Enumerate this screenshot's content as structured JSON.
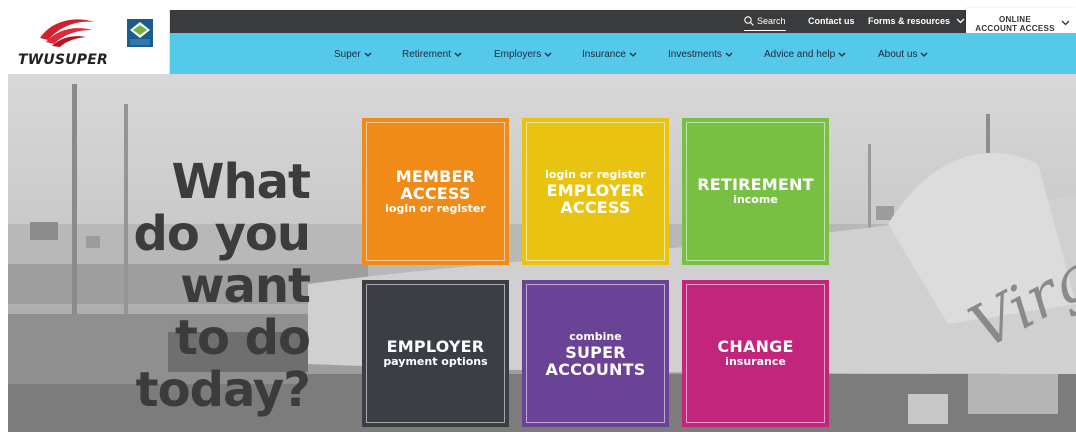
{
  "logo": {
    "text": "TWUSUPER"
  },
  "utility": {
    "search_label": "Search",
    "contact_label": "Contact us",
    "forms_label": "Forms & resources"
  },
  "online_access": {
    "line1": "ONLINE",
    "line2": "ACCOUNT ACCESS"
  },
  "nav": {
    "items": [
      {
        "label": "Super"
      },
      {
        "label": "Retirement"
      },
      {
        "label": "Employers"
      },
      {
        "label": "Insurance"
      },
      {
        "label": "Investments"
      },
      {
        "label": "Advice and help"
      },
      {
        "label": "About us"
      }
    ]
  },
  "hero": {
    "headline_lines": [
      "What",
      "do you",
      "want",
      "to do",
      "today?"
    ],
    "plane_text": "Virgin"
  },
  "tiles": {
    "member": {
      "big1": "MEMBER",
      "big2": "ACCESS",
      "small": "login or register"
    },
    "employer_access": {
      "small": "login or register",
      "big1": "EMPLOYER",
      "big2": "ACCESS"
    },
    "retirement": {
      "big": "RETIREMENT",
      "small": "income"
    },
    "employer_pay": {
      "big": "EMPLOYER",
      "small": "payment options"
    },
    "combine": {
      "small": "combine",
      "big1": "SUPER",
      "big2": "ACCOUNTS"
    },
    "change": {
      "big": "CHANGE",
      "small": "insurance"
    }
  },
  "colors": {
    "nav_bg": "#55c9ea",
    "utility_bg": "#3a3b3d",
    "member_tile": "#f08b17",
    "employer_access_tile": "#e9c311",
    "retirement_tile": "#77c043",
    "employer_payment_tile": "#3b3e45",
    "combine_tile": "#6a4396",
    "change_tile": "#c3257c"
  },
  "icons": {
    "search": "search-icon",
    "chevron": "chevron-down-icon",
    "logo_swoosh": "twusuper-swoosh-icon",
    "seal": "award-seal-icon"
  }
}
